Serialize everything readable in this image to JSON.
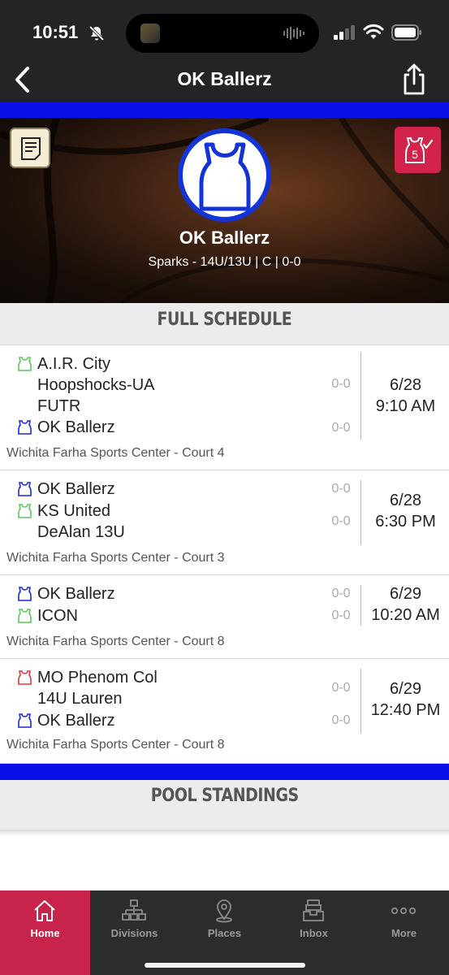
{
  "status_bar": {
    "time": "10:51",
    "icons": [
      "bell-slash-icon",
      "cellular-signal-icon",
      "wifi-icon",
      "battery-icon"
    ]
  },
  "nav": {
    "title": "OK Ballerz",
    "back_icon": "chevron-left-icon",
    "share_icon": "share-icon"
  },
  "team": {
    "name": "OK Ballerz",
    "subtitle": "Sparks - 14U/13U | C | 0-0",
    "logo_icon": "jersey-icon",
    "notes_icon": "notes-icon",
    "badge_icon": "jersey-check-icon",
    "badge_count": "5"
  },
  "schedule": {
    "header": "FULL SCHEDULE",
    "games": [
      {
        "team1": {
          "line1": "A.I.R. City",
          "line2": "Hoopshocks-UA",
          "line3": "FUTR",
          "color": "#5cc85c",
          "score": "0-0"
        },
        "team2": {
          "line1": "OK Ballerz",
          "color": "#1c2ad6",
          "score": "0-0"
        },
        "date": "6/28",
        "time": "9:10 AM",
        "venue": "Wichita Farha Sports Center - Court 4"
      },
      {
        "team1": {
          "line1": "OK Ballerz",
          "color": "#1c2ad6",
          "score": "0-0"
        },
        "team2": {
          "line1": "KS United",
          "line2": "DeAlan 13U",
          "color": "#5cc85c",
          "score": "0-0"
        },
        "date": "6/28",
        "time": "6:30 PM",
        "venue": "Wichita Farha Sports Center - Court 3"
      },
      {
        "team1": {
          "line1": "OK Ballerz",
          "color": "#1c2ad6",
          "score": "0-0"
        },
        "team2": {
          "line1": "ICON",
          "color": "#5cc85c",
          "score": "0-0"
        },
        "date": "6/29",
        "time": "10:20 AM",
        "venue": "Wichita Farha Sports Center - Court 8"
      },
      {
        "team1": {
          "line1": "MO Phenom Col",
          "line2": "14U Lauren",
          "color": "#e23b3b",
          "score": "0-0"
        },
        "team2": {
          "line1": "OK Ballerz",
          "color": "#1c2ad6",
          "score": "0-0"
        },
        "date": "6/29",
        "time": "12:40 PM",
        "venue": "Wichita Farha Sports Center - Court 8"
      }
    ]
  },
  "standings": {
    "header": "POOL STANDINGS"
  },
  "tabbar": {
    "items": [
      {
        "label": "Home",
        "icon": "home-icon",
        "active": true
      },
      {
        "label": "Divisions",
        "icon": "divisions-icon",
        "active": false
      },
      {
        "label": "Places",
        "icon": "map-pin-icon",
        "active": false
      },
      {
        "label": "Inbox",
        "icon": "inbox-icon",
        "active": false
      },
      {
        "label": "More",
        "icon": "more-icon",
        "active": false
      }
    ]
  },
  "colors": {
    "accent_red": "#c8234a",
    "stripe_blue": "#0a10e8",
    "dark_bg": "#222426"
  }
}
